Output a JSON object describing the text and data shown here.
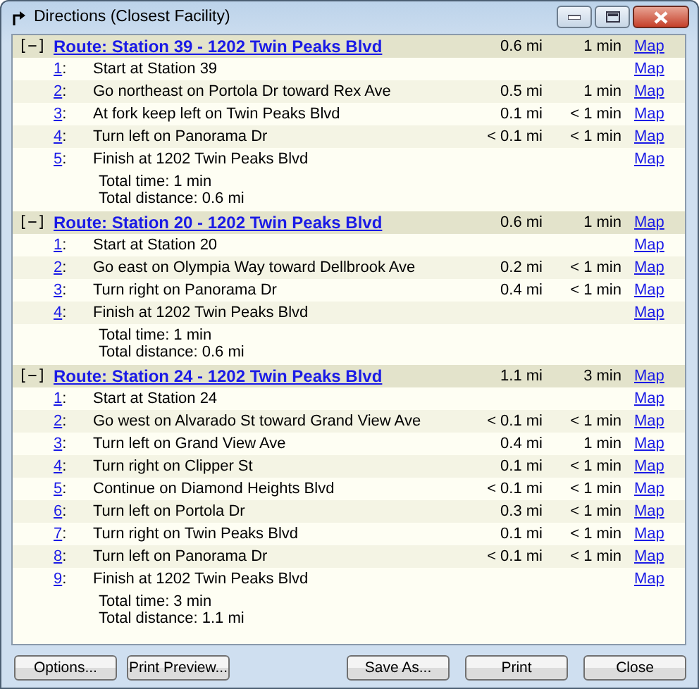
{
  "window": {
    "title": "Directions (Closest Facility)"
  },
  "routes": [
    {
      "expanded": true,
      "toggle": "[−]",
      "title": "Route: Station 39 - 1202 Twin Peaks Blvd",
      "distance": "0.6 mi",
      "time": "1 min",
      "map": "Map",
      "steps": [
        {
          "number": "1",
          "colon": ":",
          "text": "Start at Station 39",
          "map": "Map"
        },
        {
          "number": "2",
          "colon": ":",
          "text": "Go northeast on Portola Dr toward Rex Ave",
          "distance": "0.5 mi",
          "time": "1 min",
          "map": "Map"
        },
        {
          "number": "3",
          "colon": ":",
          "text": "At fork keep left on Twin Peaks Blvd",
          "distance": "0.1 mi",
          "time": "< 1 min",
          "map": "Map"
        },
        {
          "number": "4",
          "colon": ":",
          "text": "Turn left on Panorama Dr",
          "distance": "< 0.1 mi",
          "time": "< 1 min",
          "map": "Map"
        },
        {
          "number": "5",
          "colon": ":",
          "text": "Finish at 1202 Twin Peaks Blvd",
          "map": "Map"
        }
      ],
      "total_time": "Total time: 1 min",
      "total_distance": "Total distance: 0.6 mi"
    },
    {
      "expanded": true,
      "toggle": "[−]",
      "title": "Route: Station 20 - 1202 Twin Peaks Blvd",
      "distance": "0.6 mi",
      "time": "1 min",
      "map": "Map",
      "steps": [
        {
          "number": "1",
          "colon": ":",
          "text": "Start at Station 20",
          "map": "Map"
        },
        {
          "number": "2",
          "colon": ":",
          "text": "Go east on Olympia Way toward Dellbrook Ave",
          "distance": "0.2 mi",
          "time": "< 1 min",
          "map": "Map"
        },
        {
          "number": "3",
          "colon": ":",
          "text": "Turn right on Panorama Dr",
          "distance": "0.4 mi",
          "time": "< 1 min",
          "map": "Map"
        },
        {
          "number": "4",
          "colon": ":",
          "text": "Finish at 1202 Twin Peaks Blvd",
          "map": "Map"
        }
      ],
      "total_time": "Total time: 1 min",
      "total_distance": "Total distance: 0.6 mi"
    },
    {
      "expanded": true,
      "toggle": "[−]",
      "title": "Route: Station 24 - 1202 Twin Peaks Blvd",
      "distance": "1.1 mi",
      "time": "3 min",
      "map": "Map",
      "steps": [
        {
          "number": "1",
          "colon": ":",
          "text": "Start at Station 24",
          "map": "Map"
        },
        {
          "number": "2",
          "colon": ":",
          "text": "Go west on Alvarado St toward Grand View Ave",
          "distance": "< 0.1 mi",
          "time": "< 1 min",
          "map": "Map"
        },
        {
          "number": "3",
          "colon": ":",
          "text": "Turn left on Grand View Ave",
          "distance": "0.4 mi",
          "time": "1 min",
          "map": "Map"
        },
        {
          "number": "4",
          "colon": ":",
          "text": "Turn right on Clipper St",
          "distance": "0.1 mi",
          "time": "< 1 min",
          "map": "Map"
        },
        {
          "number": "5",
          "colon": ":",
          "text": "Continue on Diamond Heights Blvd",
          "distance": "< 0.1 mi",
          "time": "< 1 min",
          "map": "Map"
        },
        {
          "number": "6",
          "colon": ":",
          "text": "Turn left on Portola Dr",
          "distance": "0.3 mi",
          "time": "< 1 min",
          "map": "Map"
        },
        {
          "number": "7",
          "colon": ":",
          "text": "Turn right on Twin Peaks Blvd",
          "distance": "0.1 mi",
          "time": "< 1 min",
          "map": "Map"
        },
        {
          "number": "8",
          "colon": ":",
          "text": "Turn left on Panorama Dr",
          "distance": "< 0.1 mi",
          "time": "< 1 min",
          "map": "Map"
        },
        {
          "number": "9",
          "colon": ":",
          "text": "Finish at 1202 Twin Peaks Blvd",
          "map": "Map"
        }
      ],
      "total_time": "Total time: 3 min",
      "total_distance": "Total distance: 1.1 mi"
    }
  ],
  "buttons": [
    {
      "label": "Options..."
    },
    {
      "label": "Print Preview..."
    },
    {
      "label": "Save As..."
    },
    {
      "label": "Print"
    },
    {
      "label": "Close"
    }
  ]
}
